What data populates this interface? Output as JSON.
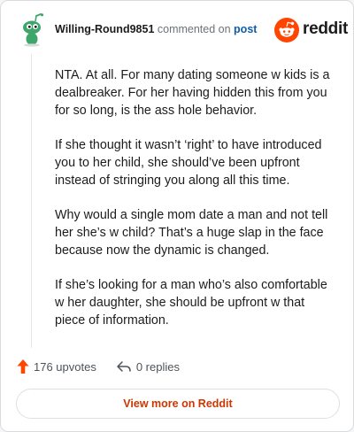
{
  "header": {
    "username": "Willing-Round9851",
    "action_text": "commented on",
    "post_link": "post",
    "brand_word": "reddit",
    "avatar_icon": "snoo-avatar-icon",
    "brand_icon": "reddit-alien-icon"
  },
  "comment": {
    "paragraphs": [
      "NTA. At all. For many dating someone w kids is a dealbreaker. For her having hidden this from you for so long, is the ass hole behavior.",
      "If she thought it wasn’t ‘right’ to have introduced you to her child, she should’ve been upfront instead of stringing you along all this time.",
      "Why would a single mom date a man and not tell her she’s w child? That’s a huge slap in the face because now the dynamic is changed.",
      "If she’s looking for a man who’s also comfortable w her daughter, she should be upfront w that piece of information."
    ]
  },
  "actions": {
    "upvotes_label": "176 upvotes",
    "replies_label": "0 replies",
    "upvote_icon": "upvote-arrow-icon",
    "reply_icon": "reply-arrow-icon"
  },
  "footer": {
    "view_more_label": "View more on Reddit"
  },
  "colors": {
    "accent": "#cc3700",
    "upvote": "#ff4500",
    "link": "#0f5ca8",
    "avatar_green": "#3fa66b"
  }
}
